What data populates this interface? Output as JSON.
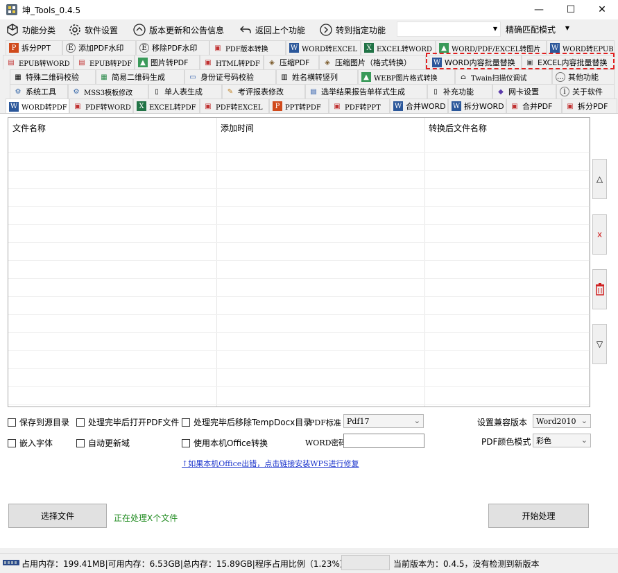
{
  "window": {
    "title": "坤_Tools_0.4.5",
    "min": "—",
    "max": "☐",
    "close": "✕"
  },
  "toolbar": {
    "items": [
      {
        "label": "功能分类",
        "icon": "cube-icon"
      },
      {
        "label": "软件设置",
        "icon": "gear-icon"
      },
      {
        "label": "版本更新和公告信息",
        "icon": "up-arrow-circle-icon"
      },
      {
        "label": "返回上个功能",
        "icon": "back-arrow-icon"
      },
      {
        "label": "转到指定功能",
        "icon": "right-arrow-circle-icon"
      }
    ],
    "search_value": "",
    "match_mode": "精确匹配模式"
  },
  "tabs": {
    "row1": [
      "拆分PPT",
      "添加PDF水印",
      "移除PDF水印",
      "PDF版本转换",
      "WORD转EXCEL",
      "EXCEL转WORD",
      "WORD/PDF/EXCEL转图片",
      "WORD转EPUB"
    ],
    "row2": [
      "EPUB转WORD",
      "EPUB转PDF",
      "图片转PDF",
      "HTML转PDF",
      "压缩PDF",
      "压缩图片（格式转换）",
      "WORD内容批量替换",
      "EXCEL内容批量替换"
    ],
    "row3": [
      "特殊二维码校验",
      "简易二维码生成",
      "身份证号码校验",
      "姓名横转竖列",
      "WEBP图片格式转换",
      "Twain扫描仪调试",
      "其他功能"
    ],
    "row4": [
      "系统工具",
      "MSS3模板修改",
      "单人表生成",
      "考评报表修改",
      "选举结果报告单样式生成",
      "补充功能",
      "网卡设置",
      "关于软件"
    ],
    "row5": [
      "WORD转PDF",
      "PDF转WORD",
      "EXCEL转PDF",
      "PDF转EXCEL",
      "PPT转PDF",
      "PDF转PPT",
      "合并WORD",
      "拆分WORD",
      "合并PDF",
      "拆分PDF"
    ]
  },
  "filelist": {
    "columns": [
      "文件名称",
      "添加时间",
      "转换后文件名称"
    ]
  },
  "side_buttons": [
    "△",
    "x",
    "",
    "▽"
  ],
  "options": {
    "save_to_source": "保存到源目录",
    "open_pdf_after": "处理完毕后打开PDF文件",
    "remove_tempdocx": "处理完毕后移除TempDocx目录",
    "pdf_standard_label": "PDF标准",
    "pdf_standard_value": "Pdf17",
    "compat_label": "设置兼容版本",
    "compat_value": "Word2010",
    "embed_fonts": "嵌入字体",
    "auto_update_fields": "自动更新域",
    "use_local_office": "使用本机Office转换",
    "word_password_label": "WORD密码",
    "word_password_value": "",
    "pdf_color_label": "PDF颜色模式",
    "pdf_color_value": "彩色",
    "repair_link": "↑如果本机Office出错，点击链接安装WPS进行修复"
  },
  "actions": {
    "select_files": "选择文件",
    "processing_status": "正在处理X个文件",
    "start": "开始处理"
  },
  "statusbar": {
    "memory": "占用内存：199.41MB|可用内存：6.53GB|总内存：15.89GB|程序占用比例（1.23%）",
    "version": "当前版本为：0.4.5，没有检测到新版本"
  }
}
